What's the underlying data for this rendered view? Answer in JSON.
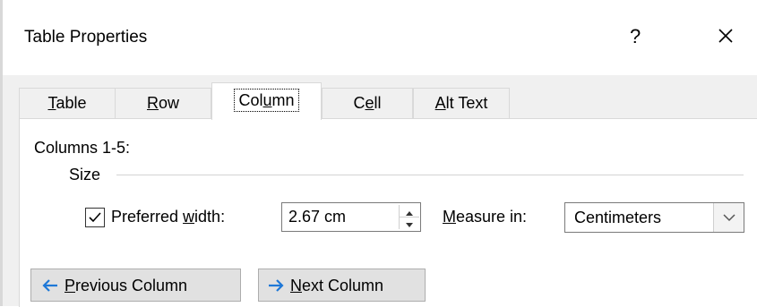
{
  "dialog": {
    "title": "Table Properties",
    "help_label": "?",
    "close_icon": "close-icon"
  },
  "tabs": [
    {
      "label_pre": "",
      "mnemonic": "T",
      "label_post": "able"
    },
    {
      "label_pre": "",
      "mnemonic": "R",
      "label_post": "ow"
    },
    {
      "label_pre": "Col",
      "mnemonic": "u",
      "label_post": "mn"
    },
    {
      "label_pre": "C",
      "mnemonic": "e",
      "label_post": "ll"
    },
    {
      "label_pre": "",
      "mnemonic": "A",
      "label_post": "lt Text"
    }
  ],
  "active_tab": "Column",
  "panel": {
    "heading": "Columns 1-5:",
    "size_group": "Size",
    "preferred_width": {
      "checked": true,
      "label_pre": "Preferred ",
      "mnemonic": "w",
      "label_post": "idth:",
      "value": "2.67 cm"
    },
    "measure_in": {
      "mnemonic": "M",
      "label_post": "easure in:",
      "value": "Centimeters"
    }
  },
  "buttons": {
    "previous": {
      "mnemonic": "P",
      "label_post": "revious Column"
    },
    "next": {
      "mnemonic": "N",
      "label_post": "ext Column"
    }
  },
  "colors": {
    "accent_arrow": "#1e78d7",
    "panel_bg": "#ffffff",
    "dialog_bg": "#f0f0f0"
  }
}
